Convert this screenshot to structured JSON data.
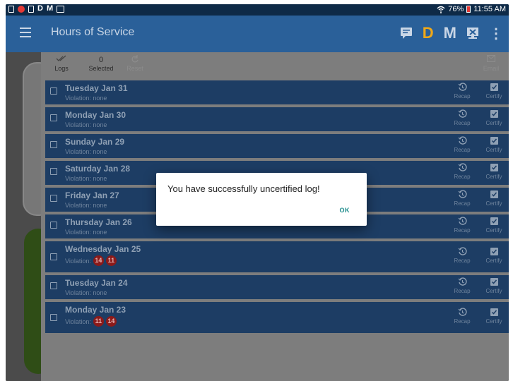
{
  "status_bar": {
    "left_icons": [
      "document-icon",
      "notification-dot-icon",
      "sd-card-icon",
      "D",
      "M",
      "image-icon"
    ],
    "battery": "76%",
    "time": "11:55 AM"
  },
  "app_bar": {
    "title": "Hours of Service",
    "duty_status": "D",
    "mode": "M"
  },
  "toolbar": {
    "logs_label": "Logs",
    "selected_count": "0",
    "selected_label": "Selected",
    "reset_label": "Reset",
    "email_label": "Email"
  },
  "logs": [
    {
      "date": "Tuesday Jan 31",
      "violation_label": "Violation: none",
      "badges": []
    },
    {
      "date": "Monday Jan 30",
      "violation_label": "Violation: none",
      "badges": []
    },
    {
      "date": "Sunday Jan 29",
      "violation_label": "Violation: none",
      "badges": []
    },
    {
      "date": "Saturday Jan 28",
      "violation_label": "Violation: none",
      "badges": []
    },
    {
      "date": "Friday Jan 27",
      "violation_label": "Violation: none",
      "badges": []
    },
    {
      "date": "Thursday Jan 26",
      "violation_label": "Violation: none",
      "badges": []
    },
    {
      "date": "Wednesday Jan 25",
      "violation_label": "Violation:",
      "badges": [
        "14",
        "11"
      ]
    },
    {
      "date": "Tuesday Jan 24",
      "violation_label": "Violation: none",
      "badges": []
    },
    {
      "date": "Monday Jan 23",
      "violation_label": "Violation:",
      "badges": [
        "11",
        "14"
      ]
    }
  ],
  "row_actions": {
    "recap": "Recap",
    "certify": "Certify"
  },
  "dialog": {
    "message": "You have successfully uncertified log!",
    "ok_label": "OK"
  },
  "colors": {
    "app_bar": "#2a6099",
    "row_bg": "#1d3d64",
    "duty_status": "#f0a818",
    "violation_badge": "#8b1a1a",
    "dialog_button": "#1a8a8a"
  }
}
